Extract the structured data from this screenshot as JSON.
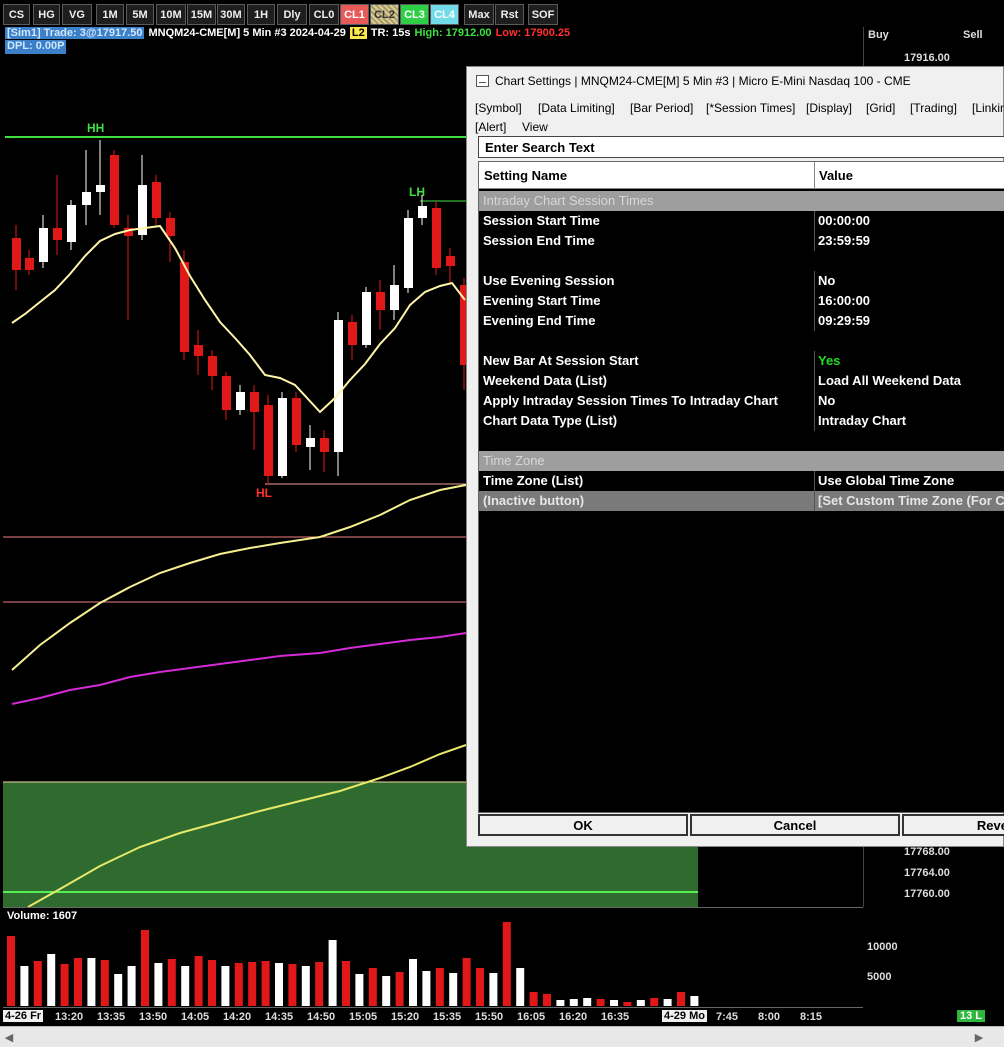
{
  "toolbar": {
    "buttons": [
      {
        "label": "CS",
        "style": "plain"
      },
      {
        "label": "HG",
        "style": "plain"
      },
      {
        "label": "VG",
        "style": "plain"
      },
      {
        "label": "1M",
        "style": "plain"
      },
      {
        "label": "5M",
        "style": "plain"
      },
      {
        "label": "10M",
        "style": "plain"
      },
      {
        "label": "15M",
        "style": "plain"
      },
      {
        "label": "30M",
        "style": "plain"
      },
      {
        "label": "1H",
        "style": "plain"
      },
      {
        "label": "Dly",
        "style": "plain"
      },
      {
        "label": "CL0",
        "style": "plain"
      },
      {
        "label": "CL1",
        "style": "red"
      },
      {
        "label": "CL2",
        "style": "pattern"
      },
      {
        "label": "CL3",
        "style": "green"
      },
      {
        "label": "CL4",
        "style": "cyan"
      },
      {
        "label": "Max",
        "style": "plain"
      },
      {
        "label": "Rst",
        "style": "plain"
      },
      {
        "label": "SOF",
        "style": "plain"
      }
    ]
  },
  "info": {
    "account": "[Sim1]  Trade: 3@17917.50",
    "symbol": "MNQM24-CME[M]  5 Min  #3 2024-04-29",
    "badge": "L2",
    "tr": "TR: 15s",
    "high": "High: 17912.00",
    "low": "Low: 17900.25",
    "dpl": "DPL: 0.00P"
  },
  "price_axis": {
    "buy": "Buy",
    "sell": "Sell",
    "labels": [
      "17916.00",
      "17768.00",
      "17764.00",
      "17760.00"
    ]
  },
  "chart_annotations": {
    "hh": "HH",
    "lh": "LH",
    "hl": "HL"
  },
  "volume": {
    "title": "Volume: 1607",
    "axis": [
      "10000",
      "5000"
    ]
  },
  "time_axis": {
    "start_box": "4-26 Fr",
    "labels": [
      "13:20",
      "13:35",
      "13:50",
      "14:05",
      "14:20",
      "14:35",
      "14:50",
      "15:05",
      "15:20",
      "15:35",
      "15:50",
      "16:05",
      "16:20",
      "16:35"
    ],
    "date_box": "4-29 Mo",
    "labels2": [
      "7:45",
      "8:00",
      "8:15"
    ],
    "count_badge": "13 L"
  },
  "dialog": {
    "title": "Chart Settings | MNQM24-CME[M]  5 Min  #3 | Micro E-Mini Nasdaq 100 - CME",
    "tabs": [
      "[Symbol]",
      "[Data Limiting]",
      "[Bar Period]",
      "[*Session Times]",
      "[Display]",
      "[Grid]",
      "[Trading]",
      "[Linkin",
      "[Alert]",
      "View"
    ],
    "search_placeholder": "Enter Search Text",
    "col_setting": "Setting Name",
    "col_value": "Value",
    "rows": [
      {
        "type": "section",
        "name": "Intraday Chart Session Times",
        "value": ""
      },
      {
        "type": "row",
        "name": "Session Start Time",
        "value": "00:00:00"
      },
      {
        "type": "row",
        "name": "Session End Time",
        "value": "23:59:59"
      },
      {
        "type": "blank",
        "name": "",
        "value": ""
      },
      {
        "type": "row",
        "name": "Use Evening Session",
        "value": "No"
      },
      {
        "type": "row",
        "name": "Evening Start Time",
        "value": "16:00:00"
      },
      {
        "type": "row",
        "name": "Evening End Time",
        "value": "09:29:59"
      },
      {
        "type": "blank",
        "name": "",
        "value": ""
      },
      {
        "type": "row-green",
        "name": "New Bar At Session Start",
        "value": "Yes"
      },
      {
        "type": "row",
        "name": "Weekend Data (List)",
        "value": "Load All Weekend Data"
      },
      {
        "type": "row",
        "name": "Apply Intraday Session Times To Intraday Chart",
        "value": "No"
      },
      {
        "type": "row",
        "name": "Chart Data Type (List)",
        "value": "Intraday Chart"
      },
      {
        "type": "blank",
        "name": "",
        "value": ""
      },
      {
        "type": "section",
        "name": "Time Zone",
        "value": ""
      },
      {
        "type": "row",
        "name": "Time Zone (List)",
        "value": "Use Global Time Zone"
      },
      {
        "type": "inactive",
        "name": " (Inactive button)",
        "value": "[Set Custom Time Zone (For C"
      }
    ],
    "ok": "OK",
    "cancel": "Cancel",
    "revert": "Reve"
  },
  "colors": {
    "up": "#ffffff",
    "down": "#e01818",
    "ma_fast": "#fff5a8",
    "ma_slow": "#e8e86a",
    "ma_magenta": "#d42ad8",
    "zone_green": "#2f6b2f",
    "hh_line": "#3ee040"
  }
}
